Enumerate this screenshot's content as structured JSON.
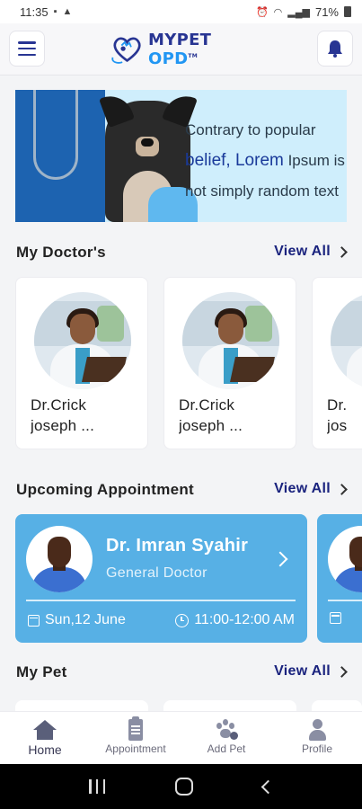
{
  "status_bar": {
    "time": "11:35",
    "battery_percent": "71%"
  },
  "header": {
    "logo_text_a": "MYPET ",
    "logo_text_b": "OPD",
    "logo_mark": "TM"
  },
  "banner": {
    "line1": "Contrary to popular",
    "line2_highlight": "belief, Lorem",
    "line2_rest": " Ipsum is",
    "line3": "not simply random text"
  },
  "sections": {
    "doctors_title": "My Doctor's",
    "appointments_title": "Upcoming Appointment",
    "pets_title": "My Pet",
    "view_all": "View All"
  },
  "doctors": [
    {
      "name_line1": "Dr.Crick",
      "name_line2": "joseph ..."
    },
    {
      "name_line1": "Dr.Crick",
      "name_line2": "joseph ..."
    },
    {
      "name_line1": "Dr.",
      "name_line2": "jos"
    }
  ],
  "appointments": [
    {
      "doctor": "Dr. Imran Syahir",
      "specialty": "General Doctor",
      "date": "Sun,12 June",
      "time": "11:00-12:00 AM"
    }
  ],
  "bottom_nav": {
    "items": [
      {
        "label": "Home",
        "icon": "home-icon",
        "active": true
      },
      {
        "label": "Appointment",
        "icon": "clipboard-icon",
        "active": false
      },
      {
        "label": "Add Pet",
        "icon": "paw-icon",
        "active": false
      },
      {
        "label": "Profile",
        "icon": "profile-icon",
        "active": false
      }
    ]
  },
  "colors": {
    "primary_navy": "#1a237e",
    "card_blue": "#57b0e5",
    "logo_blue": "#2196f3"
  }
}
